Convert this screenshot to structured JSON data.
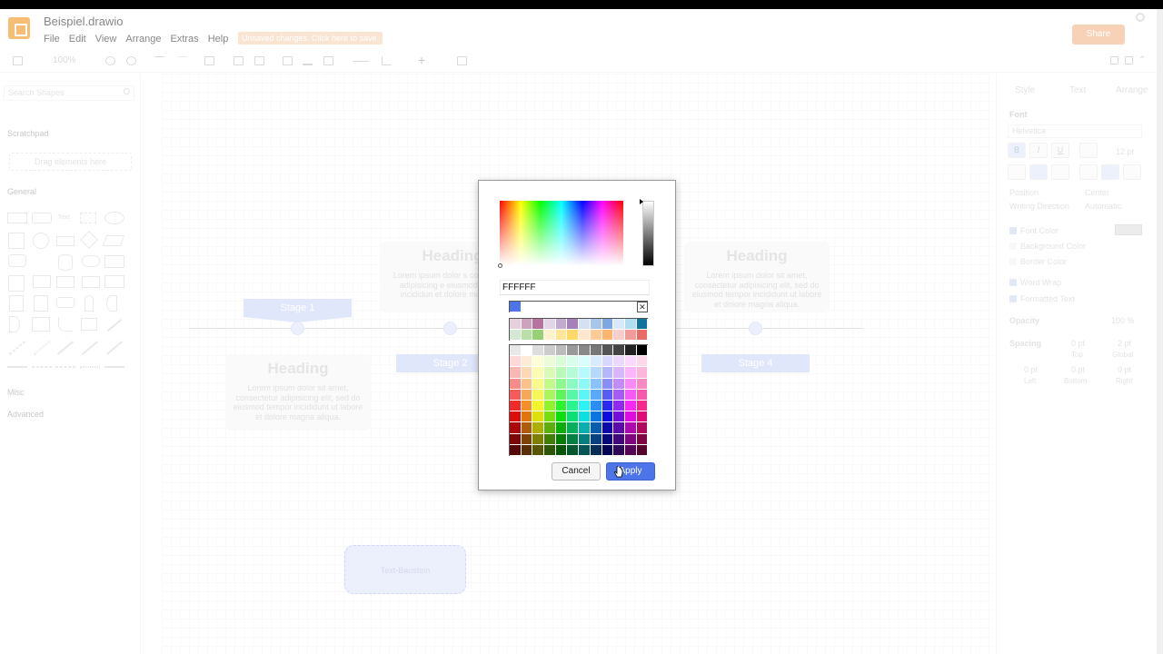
{
  "app": {
    "file_title": "Beispiel.drawio",
    "menu": [
      "File",
      "Edit",
      "View",
      "Arrange",
      "Extras",
      "Help"
    ],
    "unsaved_text": "Unsaved changes. Click here to save.",
    "share_label": "Share"
  },
  "toolbar": {
    "zoom": "100%"
  },
  "sidebar": {
    "search_placeholder": "Search Shapes",
    "scratchpad": "Scratchpad",
    "drop_hint": "Drag elements here",
    "general": "General",
    "text_shape": "Text",
    "misc": "Misc",
    "advanced": "Advanced"
  },
  "format_panel": {
    "tabs": [
      "Style",
      "Text",
      "Arrange"
    ],
    "font_label": "Font",
    "font_value": "Helvetica",
    "bold": "B",
    "italic": "I",
    "underline": "U",
    "font_size": "12 pt",
    "position_label": "Position",
    "position_value": "Center",
    "writing_label": "Writing Direction",
    "writing_value": "Automatic",
    "font_color": "Font Color",
    "background_color": "Background Color",
    "border_color": "Border Color",
    "word_wrap": "Word Wrap",
    "formatted_text": "Formatted Text",
    "opacity_label": "Opacity",
    "opacity_value": "100 %",
    "spacing_label": "Spacing",
    "spacing_top": "0 pt",
    "spacing_global": "2 pt",
    "top": "Top",
    "global": "Global",
    "spacing_left": "0 pt",
    "spacing_bottom": "0 pt",
    "spacing_right": "0 pt",
    "left": "Left",
    "bottom": "Bottom",
    "right": "Right"
  },
  "diagram": {
    "stages": [
      "Stage 1",
      "Stage 2",
      "Stage 4"
    ],
    "heading": "Heading",
    "lorem": "Lorem ipsum dolor sit amet, consectetur adipisicing elit, sed do eiusmod tempor incididunt ut labore et dolore magna aliqua.",
    "lorem_cut": "Lorem ipsum dolor s consectetur adipisicing e eiusmod tempor incididun et dolore magna ali",
    "text_block": "Text-Baustein"
  },
  "color_dialog": {
    "hex_value": "FFFFFF",
    "cancel": "Cancel",
    "apply": "Apply",
    "colors": {
      "accent": "#4d74e8",
      "stage": "#c9d3f7"
    }
  }
}
